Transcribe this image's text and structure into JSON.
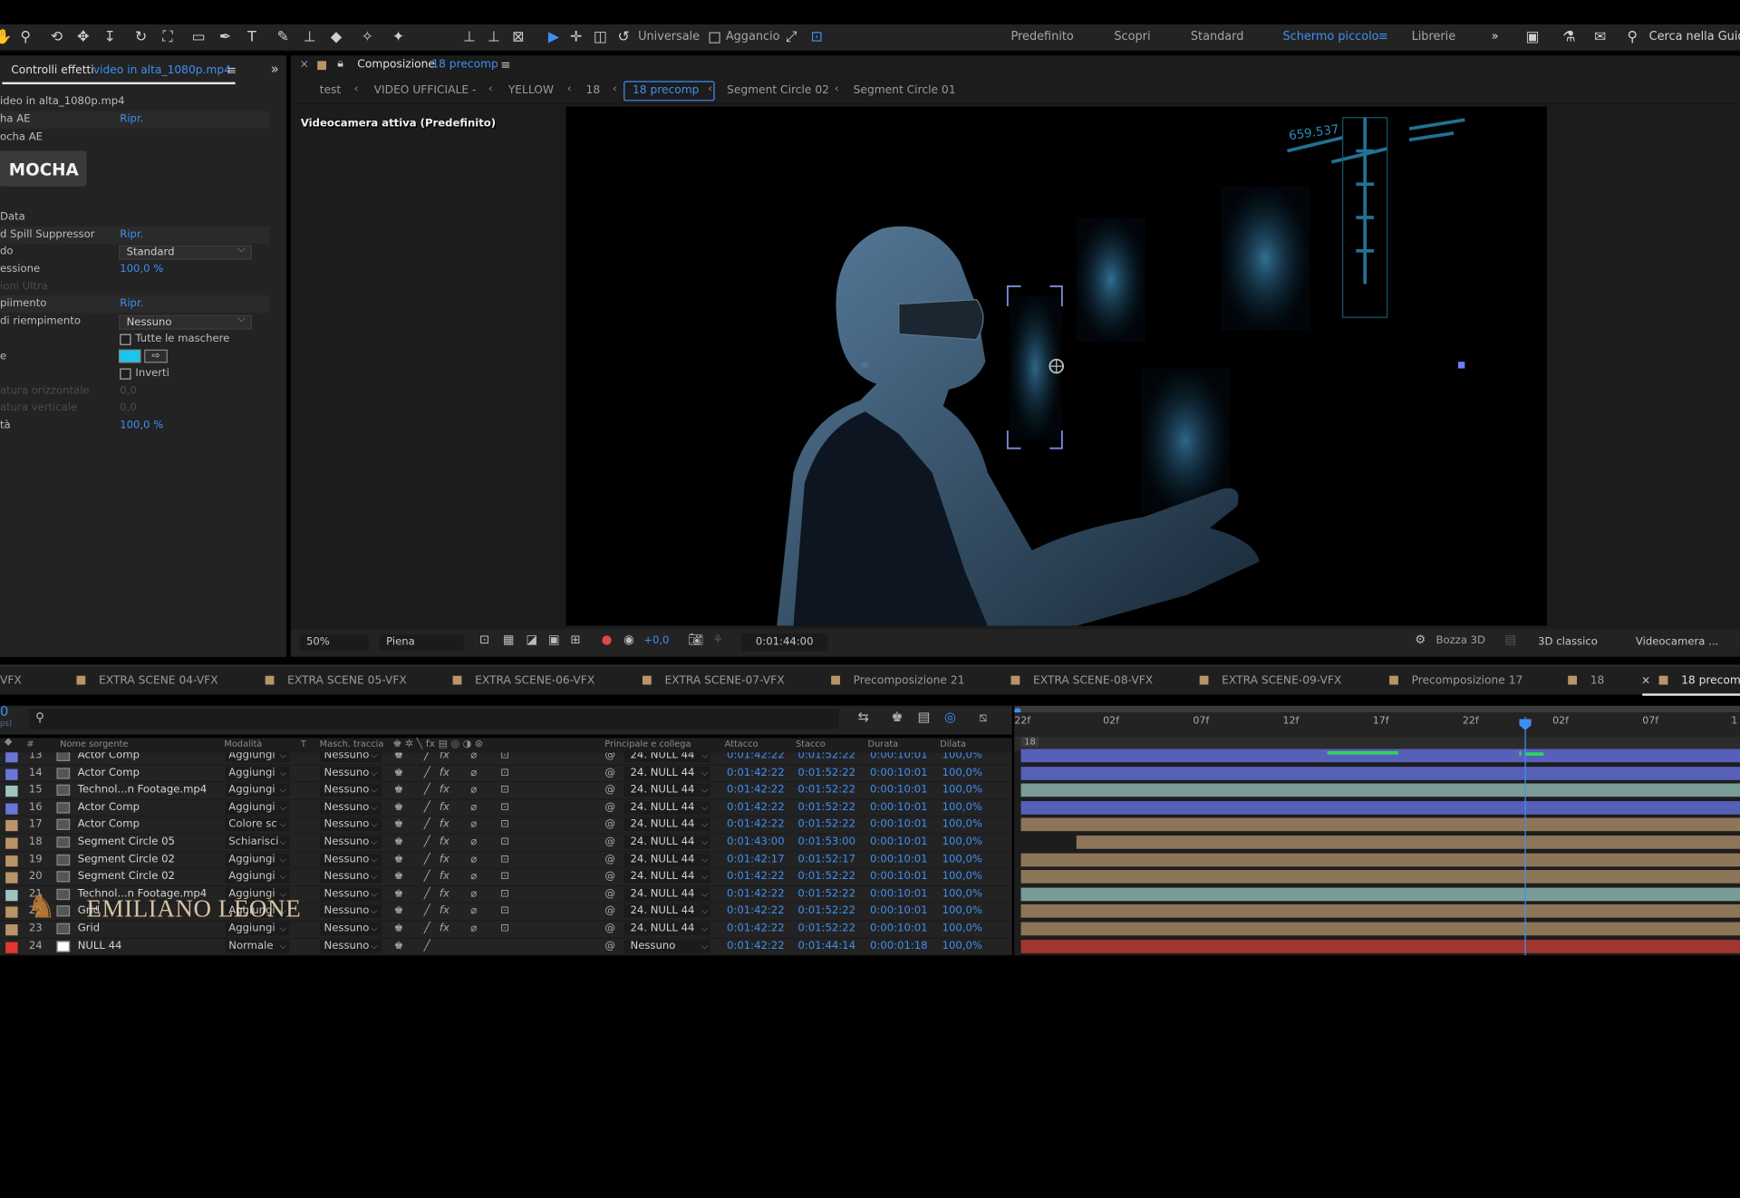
{
  "toolbar": {
    "universal_label": "Universale",
    "snap_label": "Aggancio",
    "workspaces": [
      "Predefinito",
      "Scopri",
      "Standard",
      "Schermo piccolo",
      "Librerie"
    ],
    "active_workspace": "Schermo piccolo",
    "search_label": "Cerca nella Guida"
  },
  "effects_panel": {
    "title": "Controlli effetti",
    "file": "video in alta_1080p.mp4",
    "layer_path": "ideo in alta_1080p.mp4",
    "items": [
      {
        "label": "ha AE",
        "value": "Ripr."
      },
      {
        "label": "ocha AE",
        "value": ""
      }
    ],
    "mocha_label": "MOCHA",
    "data_label": "Data",
    "spill_label": "d Spill Suppressor",
    "spill_value": "Ripr.",
    "mode_label": "do",
    "mode_value": "Standard",
    "suppression_label": "essione",
    "suppression_value": "100,0 %",
    "ultra_label": "ioni Ultra",
    "fill_label": "piimento",
    "fill_value": "Ripr.",
    "fill_mode_label": "di riempimento",
    "fill_mode_value": "Nessuno",
    "all_masks_label": "Tutte le maschere",
    "color_label": "e",
    "invert_label": "Inverti",
    "h_label": "atura orizzontale",
    "h_value": "0,0",
    "v_label": "atura verticale",
    "v_value": "0,0",
    "opacity_label": "tà",
    "opacity_value": "100,0 %"
  },
  "composition": {
    "title_prefix": "Composizione",
    "title": "18 precomp",
    "breadcrumbs": [
      "test",
      "VIDEO UFFICIALE -",
      "YELLOW",
      "18",
      "18 precomp",
      "Segment Circle 02",
      "Segment Circle 01"
    ],
    "active_crumb": "18 precomp",
    "camera_label": "Videocamera attiva (Predefinito)",
    "hud_text": "659.537"
  },
  "viewer_bar": {
    "zoom": "50%",
    "resolution": "Piena",
    "exposure": "+0,0",
    "timecode": "0:01:44:00",
    "draft3d": "Bozza 3D",
    "renderer": "3D classico",
    "camera": "Videocamera ..."
  },
  "timeline_tabs": [
    "VFX",
    "EXTRA SCENE 04-VFX",
    "EXTRA SCENE 05-VFX",
    "EXTRA SCENE-06-VFX",
    "EXTRA SCENE-07-VFX",
    "Precomposizione 21",
    "EXTRA SCENE-08-VFX",
    "EXTRA SCENE-09-VFX",
    "Precomposizione 17",
    "18",
    "18 precomp"
  ],
  "timeline": {
    "time_display": "0",
    "fps_note": "ps)",
    "columns": [
      "#",
      "Nome sorgente",
      "Modalità",
      "T",
      "Masch. traccia",
      "Principale e collega",
      "Attacco",
      "Stacco",
      "Durata",
      "Dilata"
    ],
    "ruler": [
      "22f",
      "02f",
      "07f",
      "12f",
      "17f",
      "22f",
      "02f",
      "07f",
      "1"
    ],
    "marker": "18",
    "layers": [
      {
        "num": "13",
        "name": "Actor Comp",
        "mode": "Aggiungi",
        "matte": "Nessuno",
        "parent": "24. NULL 44",
        "in": "0:01:42:22",
        "out": "0:01:52:22",
        "dur": "0:00:10:01",
        "stretch": "100,0%",
        "color": "#6a75d6",
        "icon": "comp"
      },
      {
        "num": "14",
        "name": "Actor Comp",
        "mode": "Aggiungi",
        "matte": "Nessuno",
        "parent": "24. NULL 44",
        "in": "0:01:42:22",
        "out": "0:01:52:22",
        "dur": "0:00:10:01",
        "stretch": "100,0%",
        "color": "#6a75d6",
        "icon": "comp"
      },
      {
        "num": "15",
        "name": "Technol...n Footage.mp4",
        "mode": "Aggiungi",
        "matte": "Nessuno",
        "parent": "24. NULL 44",
        "in": "0:01:42:22",
        "out": "0:01:52:22",
        "dur": "0:00:10:01",
        "stretch": "100,0%",
        "color": "#9fc3bd",
        "icon": "file"
      },
      {
        "num": "16",
        "name": "Actor Comp",
        "mode": "Aggiungi",
        "matte": "Nessuno",
        "parent": "24. NULL 44",
        "in": "0:01:42:22",
        "out": "0:01:52:22",
        "dur": "0:00:10:01",
        "stretch": "100,0%",
        "color": "#6a75d6",
        "icon": "comp"
      },
      {
        "num": "17",
        "name": "Actor Comp",
        "mode": "Colore sc",
        "matte": "Nessuno",
        "parent": "24. NULL 44",
        "in": "0:01:42:22",
        "out": "0:01:52:22",
        "dur": "0:00:10:01",
        "stretch": "100,0%",
        "color": "#b99468",
        "icon": "comp"
      },
      {
        "num": "18",
        "name": "Segment Circle 05",
        "mode": "Schiarisci",
        "matte": "Nessuno",
        "parent": "24. NULL 44",
        "in": "0:01:43:00",
        "out": "0:01:53:00",
        "dur": "0:00:10:01",
        "stretch": "100,0%",
        "color": "#b99468",
        "icon": "comp"
      },
      {
        "num": "19",
        "name": "Segment Circle 02",
        "mode": "Aggiungi",
        "matte": "Nessuno",
        "parent": "24. NULL 44",
        "in": "0:01:42:17",
        "out": "0:01:52:17",
        "dur": "0:00:10:01",
        "stretch": "100,0%",
        "color": "#b99468",
        "icon": "comp"
      },
      {
        "num": "20",
        "name": "Segment Circle 02",
        "mode": "Aggiungi",
        "matte": "Nessuno",
        "parent": "24. NULL 44",
        "in": "0:01:42:22",
        "out": "0:01:52:22",
        "dur": "0:00:10:01",
        "stretch": "100,0%",
        "color": "#b99468",
        "icon": "comp"
      },
      {
        "num": "21",
        "name": "Technol...n Footage.mp4",
        "mode": "Aggiungi",
        "matte": "Nessuno",
        "parent": "24. NULL 44",
        "in": "0:01:42:22",
        "out": "0:01:52:22",
        "dur": "0:00:10:01",
        "stretch": "100,0%",
        "color": "#9fc3bd",
        "icon": "file"
      },
      {
        "num": "22",
        "name": "Grid",
        "mode": "Aggiungi",
        "matte": "Nessuno",
        "parent": "24. NULL 44",
        "in": "0:01:42:22",
        "out": "0:01:52:22",
        "dur": "0:00:10:01",
        "stretch": "100,0%",
        "color": "#b99468",
        "icon": "comp"
      },
      {
        "num": "23",
        "name": "Grid",
        "mode": "Aggiungi",
        "matte": "Nessuno",
        "parent": "24. NULL 44",
        "in": "0:01:42:22",
        "out": "0:01:52:22",
        "dur": "0:00:10:01",
        "stretch": "100,0%",
        "color": "#b99468",
        "icon": "comp"
      },
      {
        "num": "24",
        "name": "NULL 44",
        "mode": "Normale",
        "matte": "Nessuno",
        "parent": "Nessuno",
        "in": "0:01:42:22",
        "out": "0:01:44:14",
        "dur": "0:00:01:18",
        "stretch": "100,0%",
        "color": "#e0382f",
        "icon": "null"
      }
    ]
  },
  "watermark": "EMILIANO LEONE"
}
